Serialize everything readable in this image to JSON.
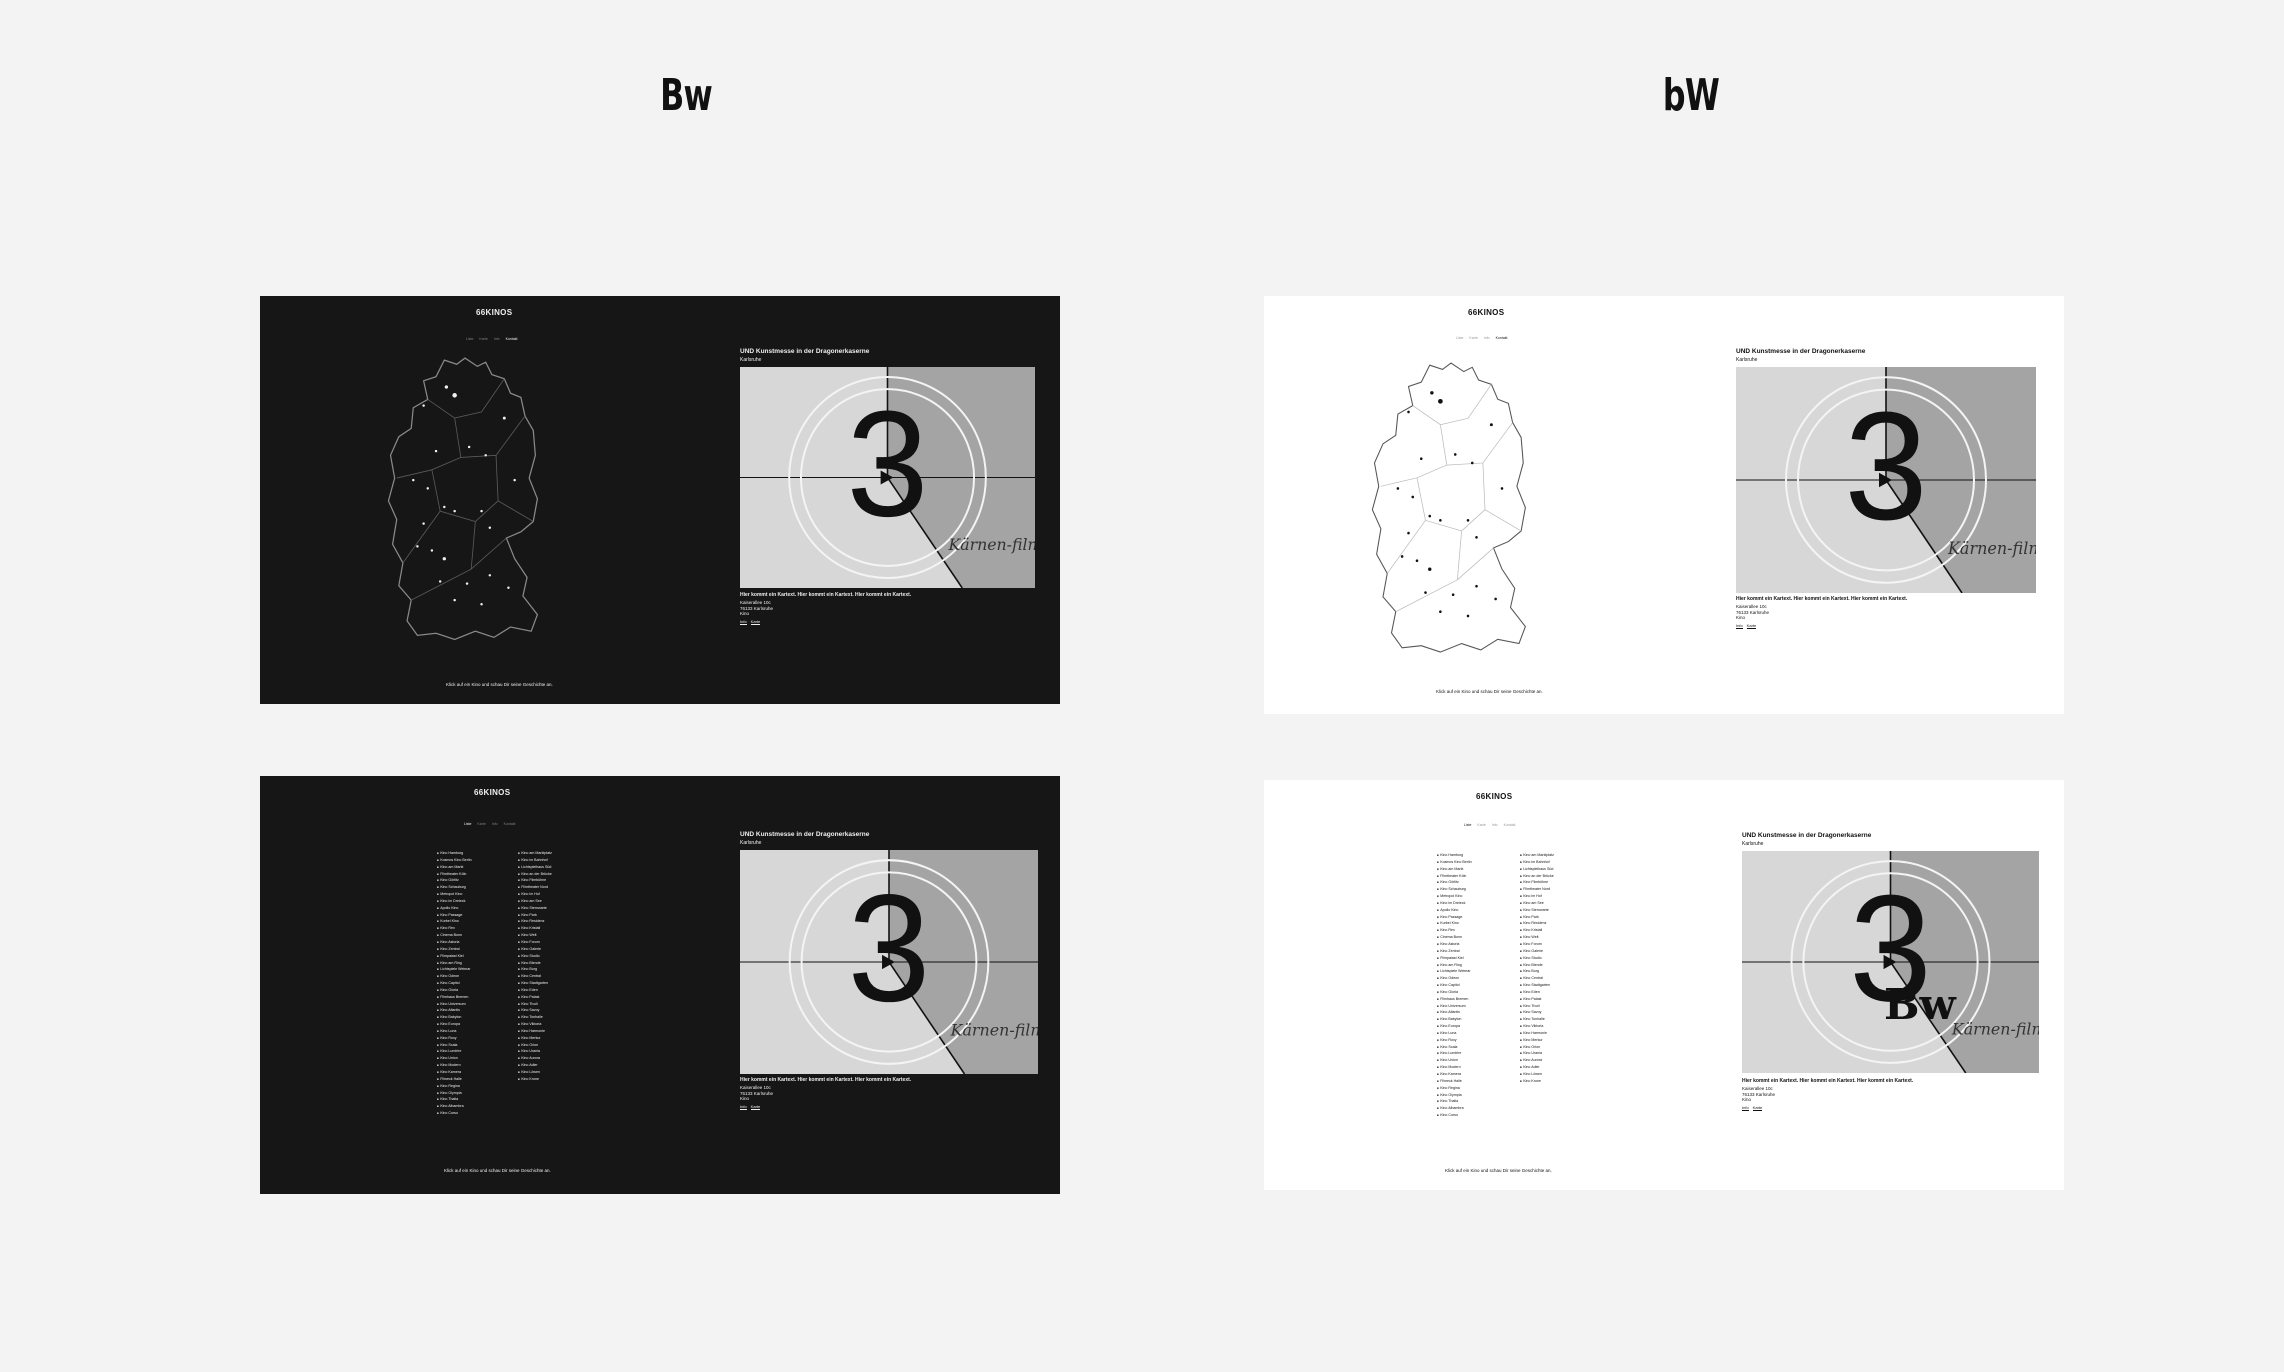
{
  "columns": [
    {
      "heading": "Bw",
      "theme": "dark"
    },
    {
      "heading": "bW",
      "theme": "light"
    }
  ],
  "site": {
    "logo": "66KINOS",
    "nav": [
      "Liste",
      "Karte",
      "Info",
      "Kontakt"
    ],
    "hint": "Klick auf ein Kino und schau Dir seine Geschichte an."
  },
  "cinema": {
    "title": "UND Kunstmesse in der Dragonerkaserne",
    "city": "Karlsruhe",
    "caption": "Hier kommt ein Kartext. Hier kommt ein Kartext. Hier kommt ein Kartext.",
    "address": [
      "Kaiserallee 10c",
      "76133 Karlsruhe",
      "Kino"
    ],
    "links": [
      "Info",
      "Karte"
    ]
  },
  "video": {
    "countdown_number": "3",
    "signature": "Kärnen-film"
  },
  "overlay_text": "Bw",
  "colors": {
    "page_bg": "#f3f3f3",
    "dark_panel": "#161616",
    "light_panel": "#ffffff",
    "video_light": "#d7d7d7",
    "video_dark": "#a4a4a4"
  },
  "cinema_list_left": [
    "Kino Hamburg",
    "Kosmos Kino Berlin",
    "Kino am Markt",
    "Filmtheater Köln",
    "Kino Görlitz",
    "Kino Schauburg",
    "Metropol Kino",
    "Kino im Dreieck",
    "Apollo Kino",
    "Kino Passage",
    "Kurbel Kino",
    "Kino Rex",
    "Cinema Bonn",
    "Kino Astoria",
    "Kino Zentral",
    "Filmpalast Kiel",
    "Kino am Ring",
    "Lichtspiele Weimar",
    "Kino Odeon",
    "Kino Capitol",
    "Kino Gloria",
    "Filmhaus Bremen",
    "Kino Universum",
    "Kino Atlantis",
    "Kino Babylon",
    "Kino Europa",
    "Kino Luna",
    "Kino Roxy",
    "Kino Scala",
    "Kino Lumière",
    "Kino Union",
    "Kino Modern",
    "Kino Kamera",
    "Filmeck Halle",
    "Kino Regina",
    "Kino Olympia",
    "Kino Thalia",
    "Kino Alhambra",
    "Kino Corso"
  ],
  "cinema_list_right": [
    "Kino am Marktplatz",
    "Kino im Bahnhof",
    "Lichtspielhaus Süd",
    "Kino an der Brücke",
    "Kino Filmbühne",
    "Filmtheater Nord",
    "Kino im Hof",
    "Kino am See",
    "Kino Sternwarte",
    "Kino Park",
    "Kino Residenz",
    "Kino Kristall",
    "Kino Welt",
    "Kino Forum",
    "Kino Galerie",
    "Kino Studio",
    "Kino Blende",
    "Kino Burg",
    "Kino Central",
    "Kino Stadtgarten",
    "Kino Eden",
    "Kino Palast",
    "Kino Tivoli",
    "Kino Savoy",
    "Kino Tonhalle",
    "Kino Viktoria",
    "Kino Harmonie",
    "Kino Merkur",
    "Kino Orion",
    "Kino Urania",
    "Kino Aurora",
    "Kino Adler",
    "Kino Löwen",
    "Kino Krone"
  ]
}
